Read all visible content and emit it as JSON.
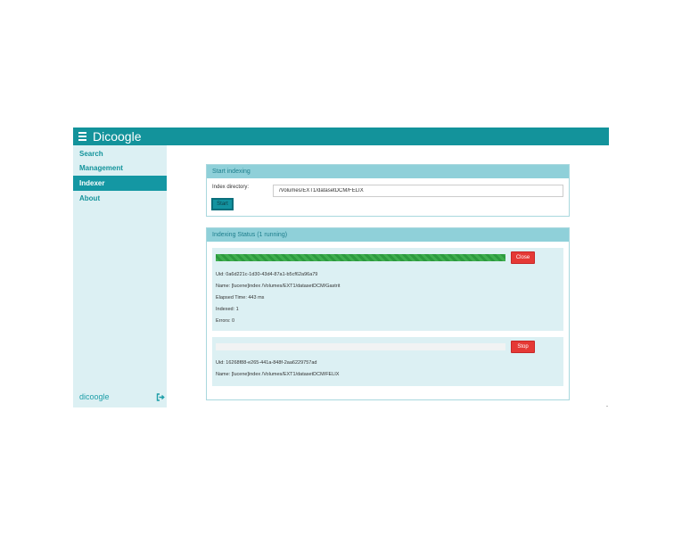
{
  "header": {
    "title": "Dicoogle"
  },
  "sidebar": {
    "items": [
      {
        "label": "Search",
        "active": false
      },
      {
        "label": "Management",
        "active": false
      },
      {
        "label": "Indexer",
        "active": true
      },
      {
        "label": "About",
        "active": false
      }
    ],
    "footer_logo": "dicoogle",
    "logout_icon": "logout-icon"
  },
  "start_panel": {
    "title": "Start indexing",
    "directory_label": "Index directory:",
    "directory_value": "/Volumes/EXT1/datasetDCM/FELIX",
    "start_button": "Start"
  },
  "status_panel": {
    "title": "Indexing Status (1 running)",
    "tasks": [
      {
        "progress": 1.0,
        "button_label": "Close",
        "uid": "Uid: 0a6d221c-1d30-43d4-87a1-b5cf62a96a79",
        "name": "Name: [lucene]index /Volumes/EXT1/datasetDCM/Gastrit",
        "elapsed": "Elapsed Time: 443 ms",
        "indexed": "Indexed: 1",
        "errors": "Errors: 0"
      },
      {
        "progress": 0.0,
        "button_label": "Stop",
        "uid": "Uid: 16268f88-e265-441a-848f-2aa6229757ad",
        "name": "Name: [lucene]index /Volumes/EXT1/datasetDCM/FELIX"
      }
    ]
  },
  "colors": {
    "brand": "#13939b",
    "sidebar_bg": "#dcf0f3",
    "panel_heading": "#8fd0d9",
    "progress": "#3fae4f",
    "danger": "#e53935"
  }
}
